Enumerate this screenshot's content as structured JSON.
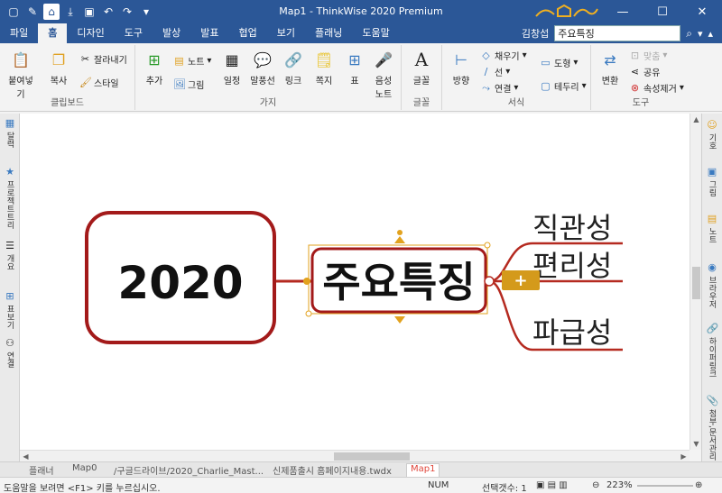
{
  "window": {
    "title": "Map1 - ThinkWise 2020 Premium",
    "controls": {
      "minimize": "—",
      "maximize": "☐",
      "close": "✕"
    }
  },
  "menu": {
    "tabs": [
      "파일",
      "홈",
      "디자인",
      "도구",
      "발상",
      "발표",
      "협업",
      "보기",
      "플래닝",
      "도움말"
    ],
    "active_tab": "홈",
    "user": "김창섭",
    "search_value": "주요특징"
  },
  "ribbon": {
    "clipboard": {
      "name": "클립보드",
      "paste": "붙여넣기",
      "copy": "복사",
      "cut": "잘라내기",
      "style": "스타일"
    },
    "branch": {
      "name": "가지",
      "add": "추가",
      "note": "노트",
      "picture": "그림",
      "schedule": "일정",
      "callout": "말풍선",
      "link": "링크",
      "memo": "쪽지",
      "table": "표",
      "voice_note": "음성\n노트"
    },
    "font": {
      "name": "글꼴",
      "font": "글꼴"
    },
    "format": {
      "name": "서식",
      "direction": "방향",
      "fill": "채우기",
      "line": "선",
      "connect": "연결",
      "shape": "도형",
      "border": "테두리"
    },
    "tools": {
      "name": "도구",
      "convert": "변환",
      "fit": "맞춤",
      "share": "공유",
      "remove_attr": "속성제거"
    }
  },
  "left_panel": [
    "달력",
    "프로젝트트리",
    "개요",
    "표보기",
    "연결"
  ],
  "right_panel": [
    "기호",
    "그림",
    "노트",
    "브라우저",
    "하이퍼링크",
    "첨부,문서관리"
  ],
  "mindmap": {
    "root": "2020",
    "main": "주요특징",
    "branches": [
      "직관성",
      "편리성",
      "파급성"
    ],
    "add_button": "+",
    "colors": {
      "border": "#a31a1a",
      "branch": "#b52a20",
      "handle": "#e2a21e",
      "add_bg": "#d49a1b"
    }
  },
  "doc_tabs": [
    "플래너",
    "Map0",
    "/구글드라이브/2020_Charlie_Mast...",
    "신제품출시 홈페이지내용.twdx",
    "Map1"
  ],
  "active_doc_tab": "Map1",
  "status": {
    "help": "도움말을 보려면 <F1> 키를 누르십시오.",
    "num": "NUM",
    "selection": "선택갯수: 1",
    "zoom": "223%"
  }
}
